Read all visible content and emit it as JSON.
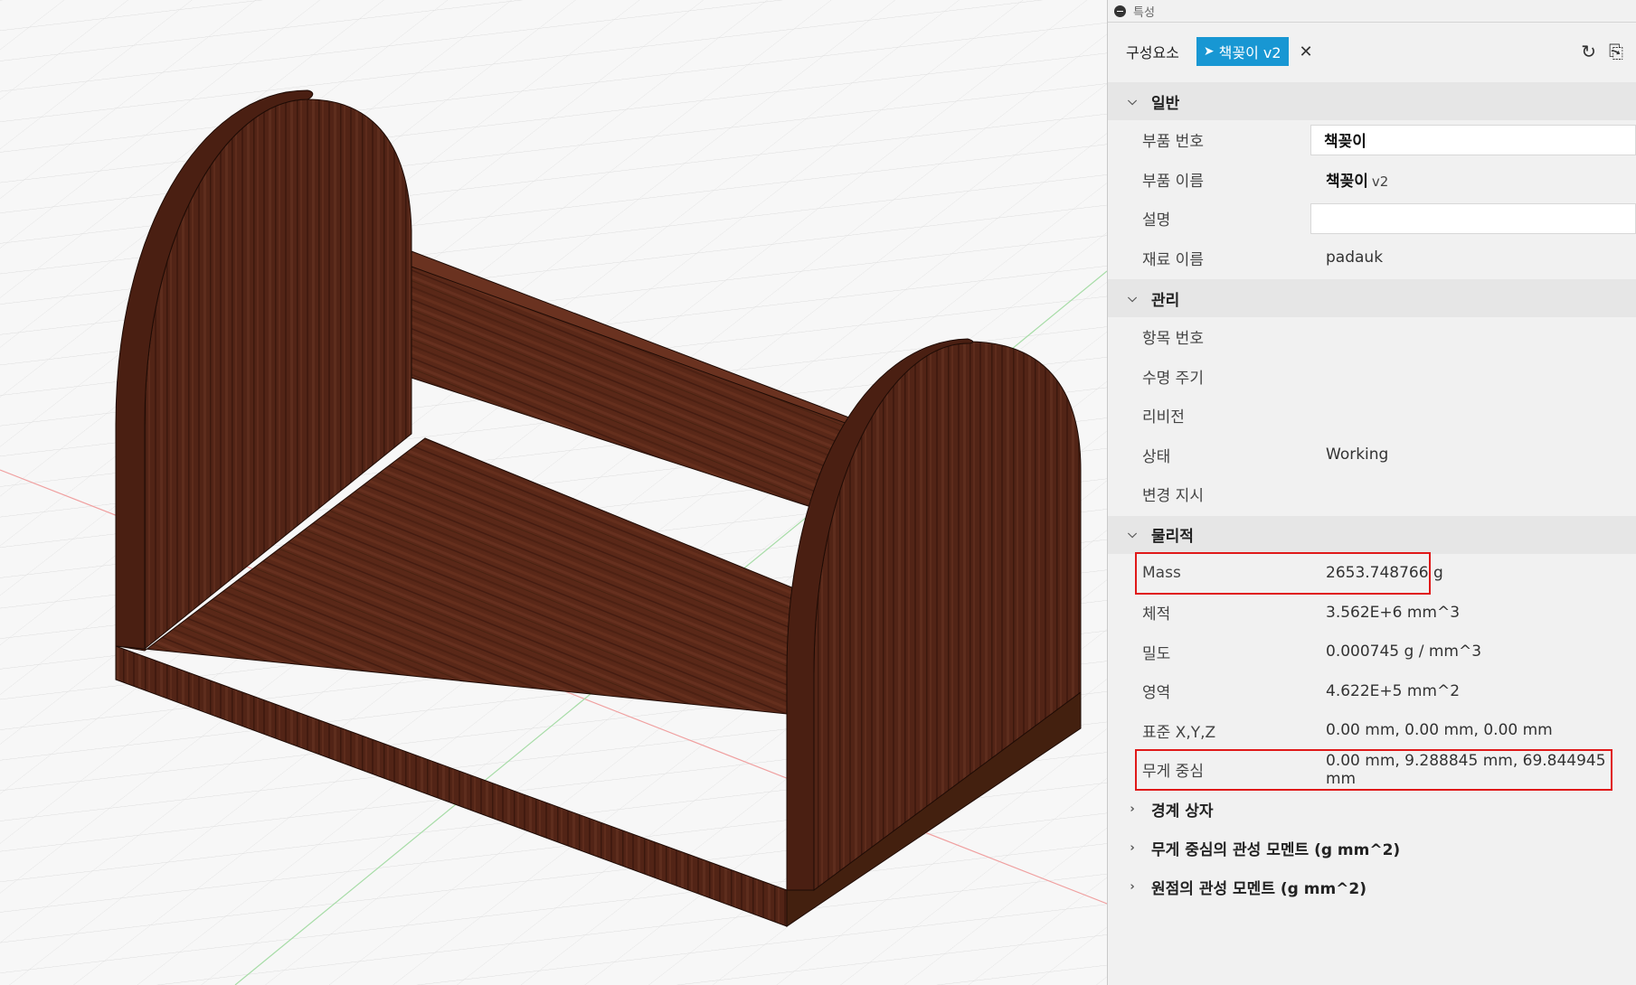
{
  "panel": {
    "header_title": "특성",
    "tab_label": "구성요소",
    "chip_label": "책꽂이 v2",
    "sections": {
      "general": {
        "title": "일반",
        "part_number": {
          "label": "부품 번호",
          "value": "책꽂이"
        },
        "part_name": {
          "label": "부품 이름",
          "value": "책꽂이",
          "version": "v2"
        },
        "description": {
          "label": "설명",
          "value": ""
        },
        "material": {
          "label": "재료 이름",
          "value": "padauk"
        }
      },
      "manage": {
        "title": "관리",
        "item_number": {
          "label": "항목 번호",
          "value": ""
        },
        "lifecycle": {
          "label": "수명 주기",
          "value": ""
        },
        "revision": {
          "label": "리비전",
          "value": ""
        },
        "state": {
          "label": "상태",
          "value": "Working"
        },
        "change_order": {
          "label": "변경 지시",
          "value": ""
        }
      },
      "physical": {
        "title": "물리적",
        "mass": {
          "label": "Mass",
          "value": "2653.748766 g"
        },
        "volume": {
          "label": "체적",
          "value": "3.562E+6 mm^3"
        },
        "density": {
          "label": "밀도",
          "value": "0.000745 g / mm^3"
        },
        "area": {
          "label": "영역",
          "value": "4.622E+5 mm^2"
        },
        "world_xyz": {
          "label": "표준 X,Y,Z",
          "value": "0.00 mm, 0.00 mm, 0.00 mm"
        },
        "center_of_mass": {
          "label": "무게 중심",
          "value": "0.00 mm, 9.288845 mm, 69.844945 mm"
        }
      },
      "bounding_box": {
        "title": "경계 상자"
      },
      "moment_com": {
        "title": "무게 중심의 관성 모멘트 (g mm^2)"
      },
      "moment_origin": {
        "title": "원점의 관성 모멘트 (g mm^2)"
      }
    }
  },
  "colors": {
    "accent": "#1897d3",
    "highlight": "#e01919",
    "wood_dark": "#4a2014",
    "wood_mid": "#5e2a1a",
    "wood_light": "#6b3320"
  }
}
